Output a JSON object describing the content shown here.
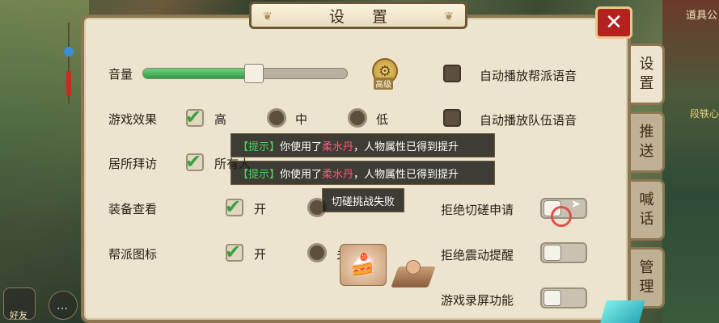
{
  "window": {
    "title": "设 置",
    "close_label": "✕"
  },
  "background": {
    "top_right_text": "道具公",
    "name_tag": "段轶心"
  },
  "hud": {
    "friend_label": "好友",
    "chat_icon": "…"
  },
  "tabs": [
    {
      "label": "设\n置",
      "active": true
    },
    {
      "label": "推\n送",
      "active": false
    },
    {
      "label": "喊\n话",
      "active": false
    },
    {
      "label": "管\n理",
      "active": false
    }
  ],
  "settings": {
    "volume": {
      "label": "音量",
      "level_percent": 55,
      "advanced_label": "高级"
    },
    "effects": {
      "label": "游戏效果",
      "options": [
        "高",
        "中",
        "低"
      ],
      "selected": "高"
    },
    "visit": {
      "label": "居所拜访",
      "options": [
        "所有人"
      ],
      "selected": "所有人"
    },
    "equip_view": {
      "label": "装备查看",
      "options": [
        "开",
        "关"
      ],
      "selected": "开"
    },
    "guild_icon": {
      "label": "帮派图标",
      "options": [
        "开",
        "关"
      ],
      "selected": "开"
    },
    "right_checkboxes": [
      {
        "label": "自动播放帮派语音",
        "checked": false
      },
      {
        "label": "自动播放队伍语音",
        "checked": false
      }
    ],
    "right_toggles": [
      {
        "label": "拒绝切磋申请",
        "on": false
      },
      {
        "label": "拒绝震动提醒",
        "on": false
      },
      {
        "label": "游戏录屏功能",
        "on": false
      }
    ]
  },
  "toasts": [
    {
      "tag": "【提示】",
      "pre": "你使用了",
      "item": "柔水丹",
      "post": "，人物属性已得到提升"
    },
    {
      "tag": "【提示】",
      "pre": "你使用了",
      "item": "柔水丹",
      "post": "，人物属性已得到提升"
    },
    {
      "text": "切磋挑战失败"
    }
  ],
  "colors": {
    "accent_green": "#3aa040",
    "close_red": "#b4221f",
    "highlight_item": "#ff5a7a",
    "notice_tag": "#4fd05a"
  }
}
